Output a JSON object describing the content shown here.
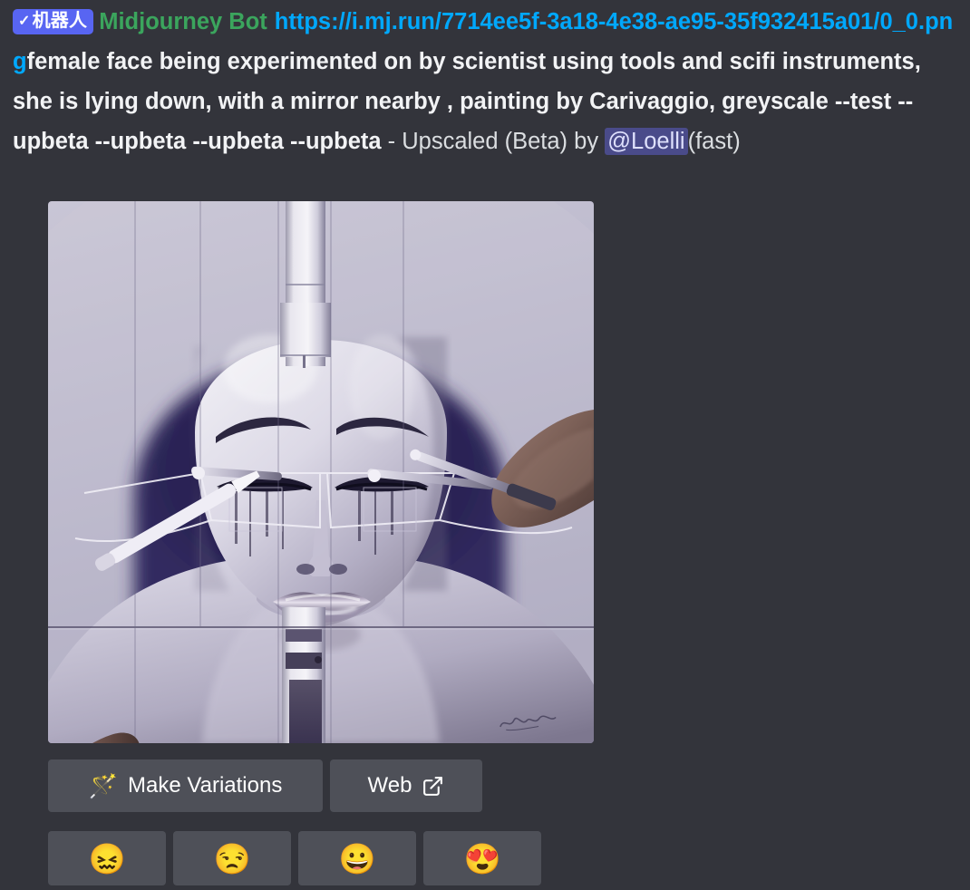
{
  "message": {
    "bot_badge": {
      "check": "✓",
      "label": "机器人"
    },
    "author": "Midjourney Bot",
    "link": "https://i.mj.run/7714ee5f-3a18-4e38-ae95-35f932415a01/0_0.png",
    "prompt": "female face being experimented on by scientist using tools and scifi instruments, she is lying down, with a mirror nearby , painting by Carivaggio, greyscale --test --upbeta --upbeta --upbeta --upbeta",
    "separator": " - ",
    "job_type": "Upscaled (Beta)",
    "by_label": " by ",
    "mention": "@Loelli",
    "speed": "(fast)"
  },
  "attachment": {
    "alt": "Greyscale painting of a female face being experimented on with scifi instruments",
    "signature": "Hyun-Joo"
  },
  "components": {
    "action_row": [
      {
        "id": "make-variations",
        "icon": "magic-wand-icon",
        "icon_glyph": "🪄",
        "label": "Make Variations"
      },
      {
        "id": "web",
        "icon": "external-link-icon",
        "label": "Web"
      }
    ],
    "reaction_row": [
      {
        "id": "confounded",
        "icon": "confounded-face-emoji",
        "glyph": "😖"
      },
      {
        "id": "unamused",
        "icon": "unamused-face-emoji",
        "glyph": "😒"
      },
      {
        "id": "grinning",
        "icon": "grinning-face-emoji",
        "glyph": "😀"
      },
      {
        "id": "heart-eyes",
        "icon": "smiling-face-with-heart-eyes-emoji",
        "glyph": "😍"
      }
    ]
  },
  "colors": {
    "background": "#33343b",
    "bot_badge": "#5865f2",
    "author": "#3ba55d",
    "link": "#00a8fc",
    "mention_bg": "#4a4b8a",
    "button_bg": "#4e5058",
    "text": "#f2f3f5"
  }
}
